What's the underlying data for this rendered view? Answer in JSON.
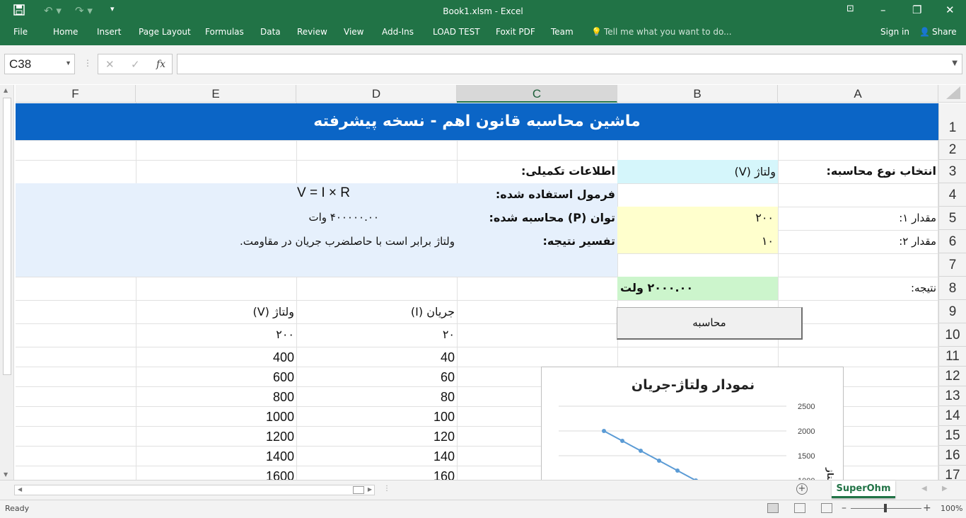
{
  "window": {
    "title": "Book1.xlsm - Excel",
    "save_icon": "save-icon",
    "undo_icon": "undo-icon",
    "redo_icon": "redo-icon"
  },
  "ribbon": {
    "tabs": [
      "File",
      "Home",
      "Insert",
      "Page Layout",
      "Formulas",
      "Data",
      "Review",
      "View",
      "Add-Ins",
      "LOAD TEST",
      "Foxit PDF",
      "Team"
    ],
    "tell_me": "Tell me what you want to do...",
    "sign_in": "Sign in",
    "share": "Share",
    "accent": "#217346"
  },
  "formula_bar": {
    "name_box": "C38",
    "fx": "fx",
    "formula": ""
  },
  "columns": [
    "F",
    "E",
    "D",
    "C",
    "B",
    "A"
  ],
  "selected_column": "C",
  "rows": [
    "1",
    "2",
    "3",
    "4",
    "5",
    "6",
    "7",
    "8",
    "9",
    "10",
    "11",
    "12",
    "13",
    "14",
    "15",
    "16",
    "17"
  ],
  "sheet": {
    "banner": "ماشین محاسبه قانون اهم - نسخه پیشرفته",
    "calc_type_label": "انتخاب نوع محاسبه:",
    "calc_type_value": "ولتاژ (V)",
    "extra_info_label": "اطلاعات تکمیلی:",
    "formula_used_label": "فرمول استفاده شده:",
    "formula_used_value": "V = I × R",
    "power_label": "توان (P) محاسبه شده:",
    "power_value": "۴۰۰۰۰۰.۰۰ وات",
    "interpretation_label": "تفسیر نتیجه:",
    "interpretation_value": "ولتاژ برابر است با حاصلضرب جریان در مقاومت.",
    "value1_label": "مقدار ۱:",
    "value1": "۲۰۰",
    "value2_label": "مقدار ۲:",
    "value2": "۱۰",
    "result_label": "نتیجه:",
    "result_value": "۲۰۰۰.۰۰ ولت",
    "calc_button": "محاسبه",
    "table": {
      "headers": [
        "جریان (I)",
        "ولتاژ (V)"
      ],
      "rows": [
        [
          "۲۰",
          "۲۰۰"
        ],
        [
          "40",
          "400"
        ],
        [
          "60",
          "600"
        ],
        [
          "80",
          "800"
        ],
        [
          "100",
          "1000"
        ],
        [
          "120",
          "1200"
        ],
        [
          "140",
          "1400"
        ],
        [
          "160",
          "1600"
        ]
      ]
    },
    "fill_colors": {
      "banner": "#0b65c6",
      "info": "#e6f0fc",
      "select": "#d5f6fb",
      "input": "#ffffcd",
      "result": "#ccf5cc"
    }
  },
  "chart_data": {
    "type": "line",
    "title": "نمودار ولتاژ-جریان",
    "ylabel": "ولتاژ (V)",
    "xlabel": "",
    "ylim": [
      0,
      2500
    ],
    "yticks": [
      "2500",
      "2000",
      "1500",
      "1000"
    ],
    "grid": true,
    "x_direction": "right-to-left",
    "series": [
      {
        "values": [
          2000,
          1800,
          1600,
          1400,
          1200,
          1000
        ]
      }
    ],
    "color": "#5b9bd5"
  },
  "sheet_tabs": [
    "SuperOhm"
  ],
  "status": {
    "ready": "Ready",
    "zoom": "100%"
  }
}
